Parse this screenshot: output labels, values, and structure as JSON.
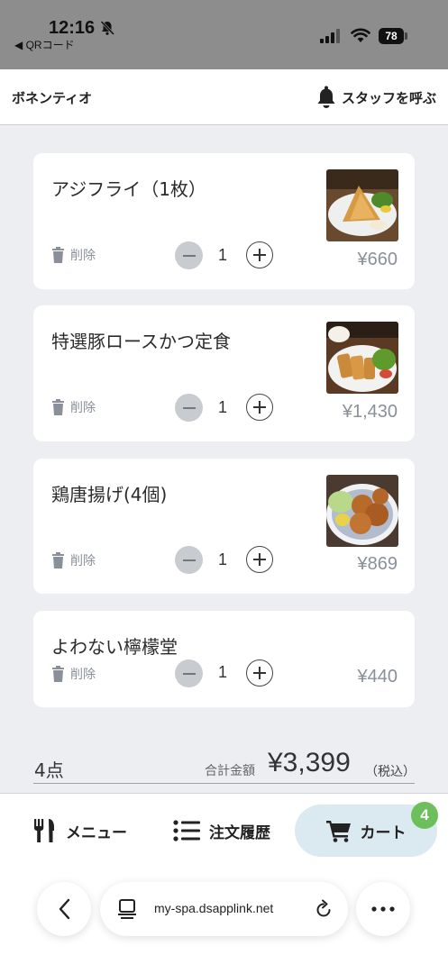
{
  "status_bar": {
    "time": "12:16",
    "back_app": "◀ QRコード",
    "battery": "78"
  },
  "header": {
    "shop_name": "ボネンティオ",
    "call_staff_label": "スタッフを呼ぶ"
  },
  "cart_items": [
    {
      "name": "アジフライ（1枚）",
      "quantity": "1",
      "price": "¥660",
      "delete_label": "削除"
    },
    {
      "name": "特選豚ロースかつ定食",
      "quantity": "1",
      "price": "¥1,430",
      "delete_label": "削除"
    },
    {
      "name": "鶏唐揚げ(4個)",
      "quantity": "1",
      "price": "¥869",
      "delete_label": "削除"
    },
    {
      "name": "よわない檸檬堂",
      "quantity": "1",
      "price": "¥440",
      "delete_label": "削除"
    }
  ],
  "summary": {
    "item_count": "4点",
    "total_label": "合計金額",
    "total_amount": "¥3,399",
    "tax_label": "（税込）"
  },
  "bottom_nav": {
    "menu_label": "メニュー",
    "history_label": "注文履歴",
    "cart_label": "カート",
    "cart_badge": "4"
  },
  "browser": {
    "url": "my-spa.dsapplink.net"
  }
}
